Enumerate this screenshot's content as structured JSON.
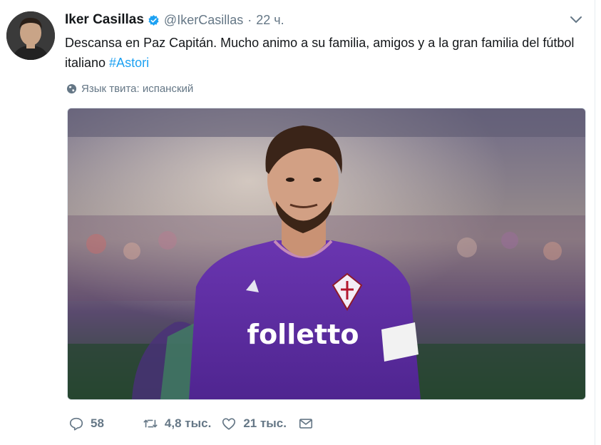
{
  "tweet": {
    "author_name": "Iker Casillas",
    "handle": "@IkerCasillas",
    "separator": "·",
    "time": "22 ч.",
    "text_main": "Descansa en Paz Capitán. Mucho animo a su familia, amigos y a la gran familia del fútbol italiano ",
    "hashtag": "#Astori",
    "language_label": "Язык твита: испанский",
    "jersey_sponsor": "folletto",
    "replies": "58",
    "retweets": "4,8 тыс.",
    "likes": "21 тыс."
  },
  "icons": {
    "verified": "verified-badge-icon",
    "menu": "chevron-down-icon",
    "language": "globe-icon",
    "reply": "reply-icon",
    "retweet": "retweet-icon",
    "like": "heart-icon",
    "dm": "envelope-icon"
  },
  "colors": {
    "link": "#1da1f2",
    "secondary_text": "#657786",
    "jersey_purple": "#5b2d9c"
  }
}
